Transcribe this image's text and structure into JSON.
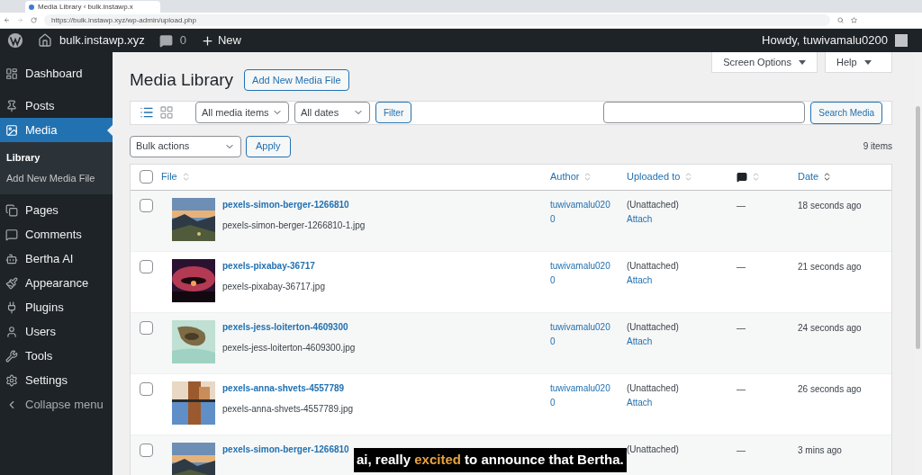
{
  "browser": {
    "tab_title": "Media Library ‹ bulk.instawp.x",
    "url": "https://bulk.instawp.xyz/wp-admin/upload.php"
  },
  "admin_bar": {
    "site": "bulk.instawp.xyz",
    "comments": "0",
    "new": "New",
    "greeting": "Howdy, tuwivamalu0200"
  },
  "sidebar": {
    "items": [
      {
        "label": "Dashboard",
        "selected": false
      },
      {
        "label": "Posts",
        "selected": false
      },
      {
        "label": "Media",
        "selected": true,
        "children": [
          {
            "label": "Library",
            "selected": true
          },
          {
            "label": "Add New Media File",
            "selected": false
          }
        ]
      },
      {
        "label": "Pages",
        "selected": false
      },
      {
        "label": "Comments",
        "selected": false
      },
      {
        "label": "Bertha AI",
        "selected": false
      },
      {
        "label": "Appearance",
        "selected": false
      },
      {
        "label": "Plugins",
        "selected": false
      },
      {
        "label": "Users",
        "selected": false
      },
      {
        "label": "Tools",
        "selected": false
      },
      {
        "label": "Settings",
        "selected": false
      },
      {
        "label": "Collapse menu",
        "selected": false
      }
    ]
  },
  "screen_options": "Screen Options",
  "help": "Help",
  "page_title": "Media Library",
  "add_new": "Add New Media File",
  "filters": {
    "views": [
      {
        "kind": "list",
        "selected": true
      },
      {
        "kind": "grid",
        "selected": false
      }
    ],
    "type": "All media items",
    "dates": "All dates",
    "filter": "Filter",
    "search_button": "Search Media"
  },
  "bulk": {
    "select": "Bulk actions",
    "apply": "Apply",
    "count": "9 items"
  },
  "table": {
    "all_checked": false,
    "columns": [
      "File",
      "Author",
      "Uploaded to",
      "Date"
    ],
    "rows": [
      {
        "title": "pexels-simon-berger-1266810",
        "file": "pexels-simon-berger-1266810-1.jpg",
        "author": "tuwivamalu0200",
        "uploaded": "(Unattached)",
        "attach": "Attach",
        "comments": "—",
        "date": "18 seconds ago",
        "checked": false
      },
      {
        "title": "pexels-pixabay-36717",
        "file": "pexels-pixabay-36717.jpg",
        "author": "tuwivamalu0200",
        "uploaded": "(Unattached)",
        "attach": "Attach",
        "comments": "—",
        "date": "21 seconds ago",
        "checked": false
      },
      {
        "title": "pexels-jess-loiterton-4609300",
        "file": "pexels-jess-loiterton-4609300.jpg",
        "author": "tuwivamalu0200",
        "uploaded": "(Unattached)",
        "attach": "Attach",
        "comments": "—",
        "date": "24 seconds ago",
        "checked": false
      },
      {
        "title": "pexels-anna-shvets-4557789",
        "file": "pexels-anna-shvets-4557789.jpg",
        "author": "tuwivamalu0200",
        "uploaded": "(Unattached)",
        "attach": "Attach",
        "comments": "—",
        "date": "26 seconds ago",
        "checked": false
      },
      {
        "title": "pexels-simon-berger-1266810",
        "uploaded": "(Unattached)",
        "comments": "—",
        "date": "3 mins ago",
        "checked": false
      }
    ]
  },
  "caption": {
    "before": "ai, really ",
    "highlight": "excited",
    "after": " to announce that Bertha."
  }
}
